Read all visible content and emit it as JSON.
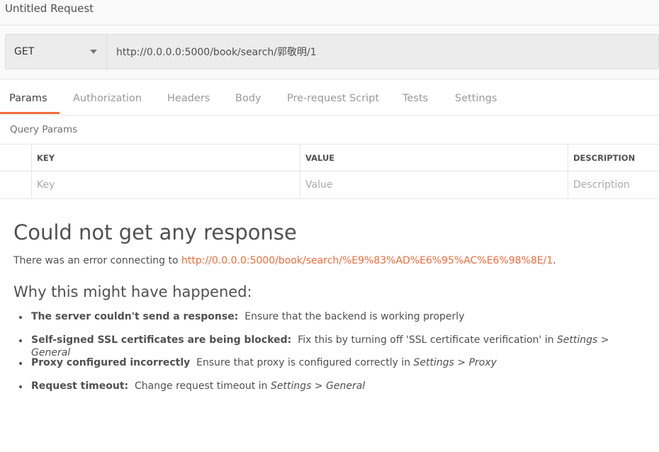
{
  "title": "Untitled Request",
  "request": {
    "method": "GET",
    "url": "http://0.0.0.0:5000/book/search/郭敬明/1"
  },
  "tabs": [
    {
      "label": "Params",
      "active": true
    },
    {
      "label": "Authorization"
    },
    {
      "label": "Headers"
    },
    {
      "label": "Body"
    },
    {
      "label": "Pre-request Script"
    },
    {
      "label": "Tests"
    },
    {
      "label": "Settings"
    }
  ],
  "accent": "#f26b3a",
  "query_params": {
    "label": "Query Params",
    "headers": [
      "KEY",
      "VALUE",
      "DESCRIPTION"
    ],
    "placeholders": [
      "Key",
      "Value",
      "Description"
    ]
  },
  "response": {
    "heading": "Could not get any response",
    "error_prefix": "There was an error connecting to ",
    "error_url": "http://0.0.0.0:5000/book/search/%E9%83%AD%E6%95%AC%E6%98%8E/1",
    "error_suffix": ".",
    "why_heading": "Why this might have happened:",
    "reasons": [
      {
        "title": "The server couldn't send a response:",
        "text": "Ensure that the backend is working properly",
        "italic": ""
      },
      {
        "title": "Self-signed SSL certificates are being blocked:",
        "text": "Fix this by turning off 'SSL certificate verification' in ",
        "italic": "Settings > General"
      },
      {
        "title": "Proxy configured incorrectly",
        "text": "Ensure that proxy is configured correctly in ",
        "italic": "Settings > Proxy"
      },
      {
        "title": "Request timeout:",
        "text": "Change request timeout in ",
        "italic": "Settings > General"
      }
    ]
  }
}
